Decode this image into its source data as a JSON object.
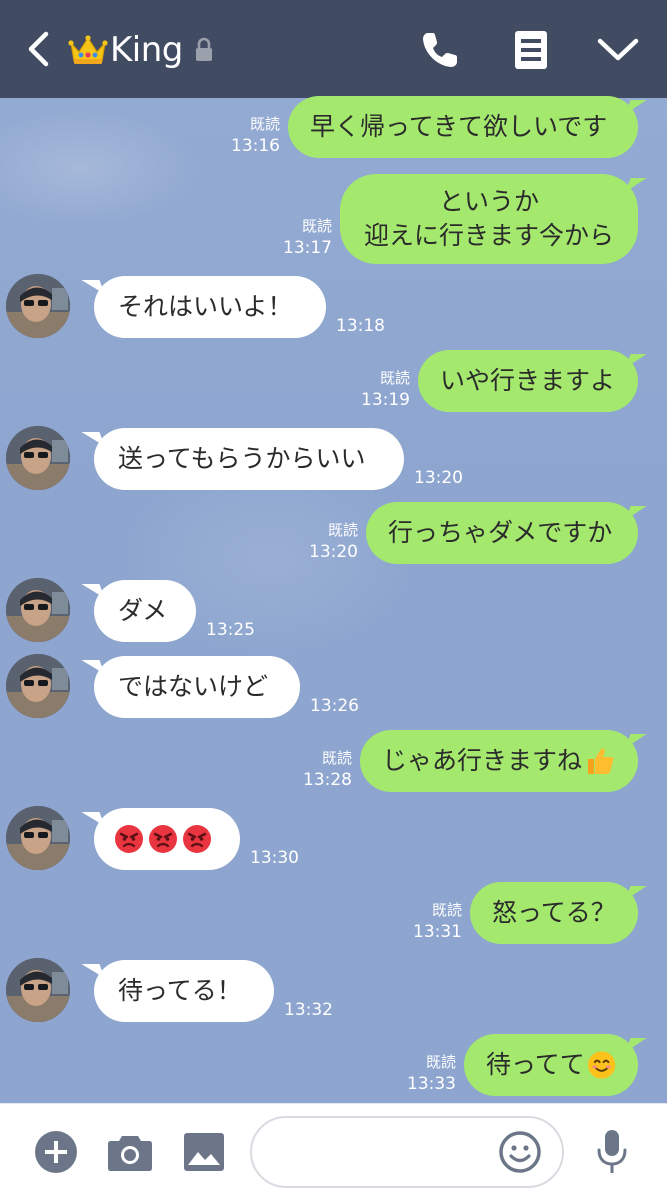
{
  "header": {
    "title": "King",
    "back_icon": "chevron-left-icon",
    "crown_icon": "crown-icon",
    "lock_icon": "lock-icon",
    "call_icon": "phone-icon",
    "notes_icon": "notes-icon",
    "menu_icon": "chevron-down-icon",
    "bg_color": "#414b61"
  },
  "messages": [
    {
      "dir": "out",
      "text": "早く帰ってきて欲しいです",
      "read": "既読",
      "time": "13:16"
    },
    {
      "dir": "out",
      "lines": [
        "というか",
        "迎えに行きます今から"
      ],
      "read": "既読",
      "time": "13:17"
    },
    {
      "dir": "in",
      "text": "それはいいよ！",
      "time": "13:18"
    },
    {
      "dir": "out",
      "text": "いや行きますよ",
      "read": "既読",
      "time": "13:19"
    },
    {
      "dir": "in",
      "text": "送ってもらうからいい",
      "time": "13:20"
    },
    {
      "dir": "out",
      "text": "行っちゃダメですか",
      "read": "既読",
      "time": "13:20"
    },
    {
      "dir": "in",
      "text": "ダメ",
      "time": "13:25"
    },
    {
      "dir": "in",
      "text": "ではないけど",
      "time": "13:26"
    },
    {
      "dir": "out",
      "text": "じゃあ行きますね",
      "emoji": "thumbs-up-icon",
      "read": "既読",
      "time": "13:28"
    },
    {
      "dir": "in",
      "emoji": "angry-face-icon x3",
      "time": "13:30"
    },
    {
      "dir": "out",
      "text": "怒ってる？",
      "read": "既読",
      "time": "13:31"
    },
    {
      "dir": "in",
      "text": "待ってる！",
      "time": "13:32"
    },
    {
      "dir": "out",
      "text": "待ってて",
      "emoji": "smiling-face-icon",
      "read": "既読",
      "time": "13:33"
    }
  ],
  "footer": {
    "add_icon": "plus-icon",
    "camera_icon": "camera-icon",
    "image_icon": "image-icon",
    "input_placeholder": "",
    "emoji_icon": "smiley-icon",
    "mic_icon": "microphone-icon"
  },
  "colors": {
    "outgoing_bubble": "#a4e86e",
    "incoming_bubble": "#ffffff",
    "chat_background": "#8fa6cc"
  }
}
